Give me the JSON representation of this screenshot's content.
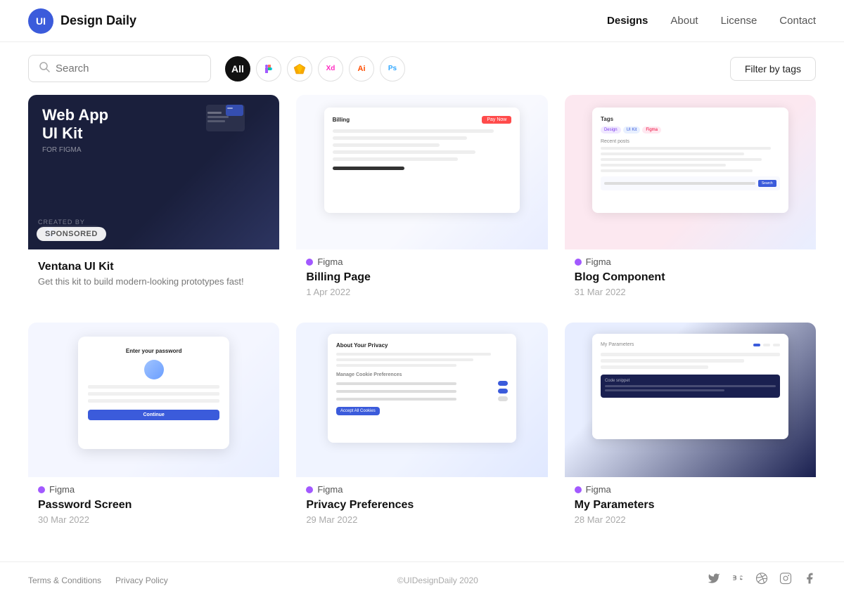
{
  "site": {
    "logo_initials": "UI",
    "logo_text": "Design Daily"
  },
  "nav": {
    "links": [
      {
        "label": "Designs",
        "active": true
      },
      {
        "label": "About",
        "active": false
      },
      {
        "label": "License",
        "active": false
      },
      {
        "label": "Contact",
        "active": false
      }
    ]
  },
  "toolbar": {
    "search_placeholder": "Search",
    "filter_tags_label": "Filter by tags",
    "pills": [
      {
        "label": "All",
        "active": true,
        "type": "all"
      },
      {
        "label": "F",
        "active": false,
        "type": "figma"
      },
      {
        "label": "◆",
        "active": false,
        "type": "sketch"
      },
      {
        "label": "Xd",
        "active": false,
        "type": "xd"
      },
      {
        "label": "Ai",
        "active": false,
        "type": "illustrator"
      },
      {
        "label": "Ps",
        "active": false,
        "type": "ps"
      }
    ]
  },
  "cards": [
    {
      "id": "ventana",
      "type": "sponsored",
      "tag": "",
      "title": "Ventana UI Kit",
      "description": "Get this kit to build modern-looking prototypes fast!",
      "date": "",
      "image_style": "ventana"
    },
    {
      "id": "billing",
      "type": "figma",
      "tag": "Figma",
      "title": "Billing Page",
      "description": "",
      "date": "1 Apr 2022",
      "image_style": "billing"
    },
    {
      "id": "blog",
      "type": "figma",
      "tag": "Figma",
      "title": "Blog Component",
      "description": "",
      "date": "31 Mar 2022",
      "image_style": "blog"
    },
    {
      "id": "password",
      "type": "figma",
      "tag": "Figma",
      "title": "Password Screen",
      "description": "",
      "date": "30 Mar 2022",
      "image_style": "password"
    },
    {
      "id": "privacy",
      "type": "figma",
      "tag": "Figma",
      "title": "Privacy Preferences",
      "description": "",
      "date": "29 Mar 2022",
      "image_style": "privacy"
    },
    {
      "id": "parameters",
      "type": "figma",
      "tag": "Figma",
      "title": "My Parameters",
      "description": "",
      "date": "28 Mar 2022",
      "image_style": "parameters"
    }
  ],
  "footer": {
    "links": [
      {
        "label": "Terms & Conditions"
      },
      {
        "label": "Privacy Policy"
      }
    ],
    "copyright": "©UIDesignDaily 2020",
    "socials": [
      "twitter",
      "behance",
      "dribbble",
      "instagram",
      "facebook"
    ]
  }
}
